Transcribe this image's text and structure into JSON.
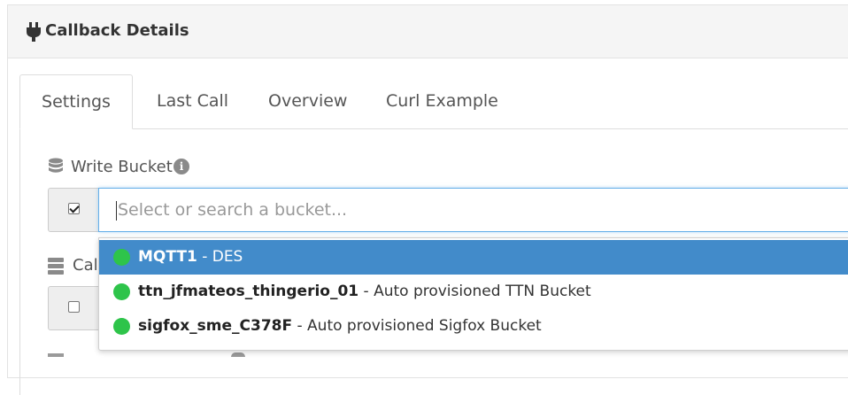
{
  "panel": {
    "title": "Callback Details",
    "icon": "plug-icon"
  },
  "tabs": [
    {
      "label": "Settings",
      "active": true
    },
    {
      "label": "Last Call",
      "active": false
    },
    {
      "label": "Overview",
      "active": false
    },
    {
      "label": "Curl Example",
      "active": false
    }
  ],
  "write_bucket": {
    "label": "Write Bucket",
    "icon": "database-icon",
    "checked": true,
    "placeholder": "Select or search a bucket..."
  },
  "callback_field": {
    "label_partial": "Call",
    "checked": false,
    "icon": "server-icon"
  },
  "dropdown": {
    "items": [
      {
        "name": "MQTT1",
        "description": "- DES",
        "status_color": "#2ec44a",
        "highlighted": true
      },
      {
        "name": "ttn_jfmateos_thingerio_01",
        "description": "- Auto provisioned TTN Bucket",
        "status_color": "#2ec44a",
        "highlighted": false
      },
      {
        "name": "sigfox_sme_C378F",
        "description": "- Auto provisioned Sigfox Bucket",
        "status_color": "#2ec44a",
        "highlighted": false
      }
    ]
  },
  "colors": {
    "accent": "#428bca",
    "focus_border": "#66afe9",
    "status_green": "#2ec44a"
  }
}
